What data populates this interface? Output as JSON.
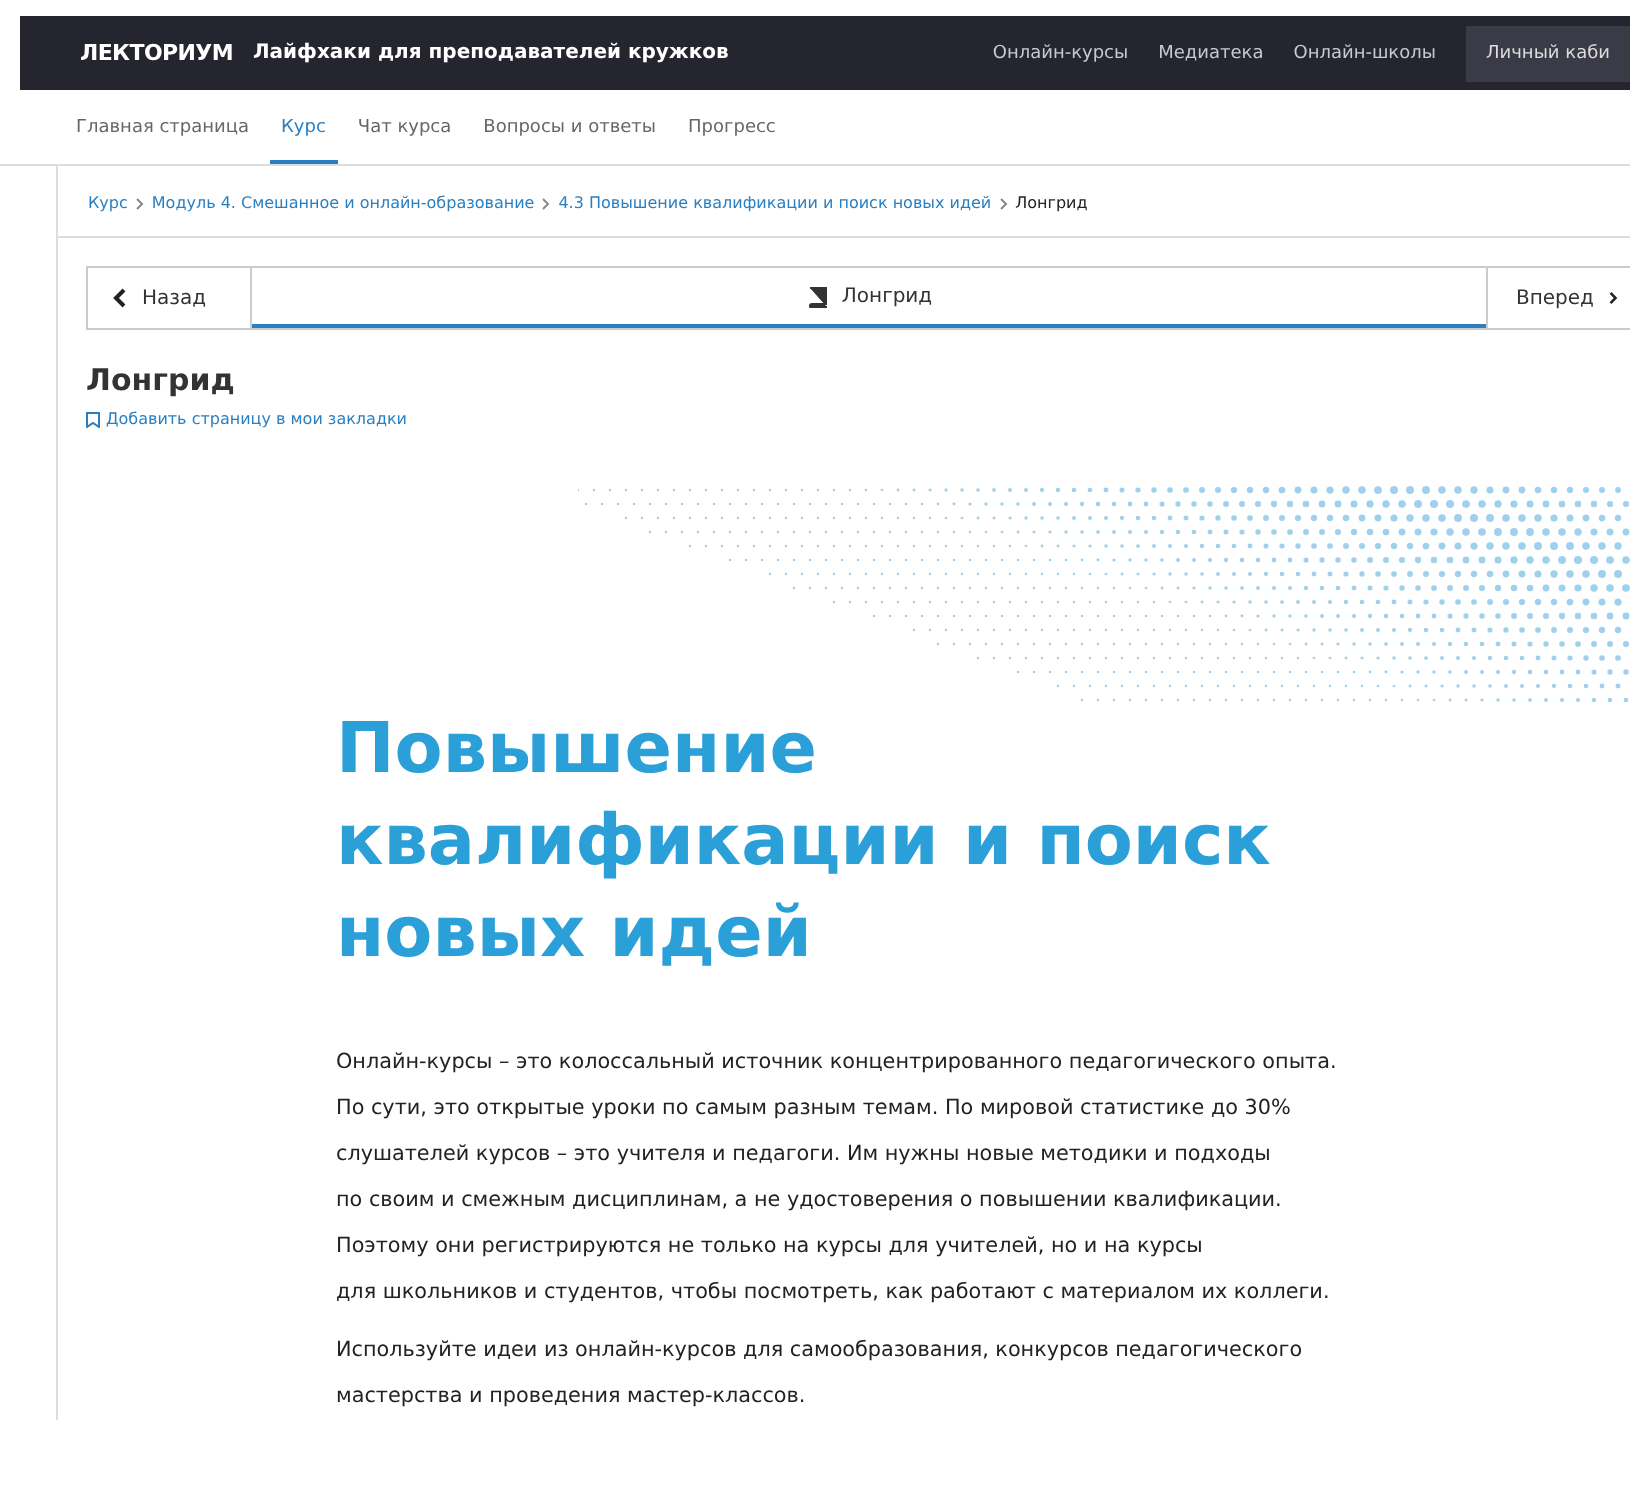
{
  "header": {
    "logo": "ЛЕКТОРИУМ",
    "title": "Лайфхаки для преподавателей кружков",
    "links": [
      "Онлайн-курсы",
      "Медиатека",
      "Онлайн-школы"
    ],
    "account_button": "Личный каби"
  },
  "tabs": [
    {
      "label": "Главная страница",
      "selected": false
    },
    {
      "label": "Курс",
      "selected": true
    },
    {
      "label": "Чат курса",
      "selected": false
    },
    {
      "label": "Вопросы и ответы",
      "selected": false
    },
    {
      "label": "Прогресс",
      "selected": false
    }
  ],
  "breadcrumbs": [
    {
      "label": "Курс",
      "current": false
    },
    {
      "label": "Модуль 4. Смешанное и онлайн-образование",
      "current": false
    },
    {
      "label": "4.3 Повышение квалификации и поиск новых идей",
      "current": false
    },
    {
      "label": "Лонгрид",
      "current": true
    }
  ],
  "unit_nav": {
    "back": "Назад",
    "current": "Лонгрид",
    "forward": "Вперед"
  },
  "page_title": "Лонгрид",
  "bookmark_link": "Добавить страницу в мои закладки",
  "article": {
    "heading_lines": [
      "Повышение",
      "квалификации и поиск",
      "новых идей"
    ],
    "paragraphs": [
      [
        "Онлайн-курсы – это колоссальный источник концентрированного педагогического опыта.",
        "По сути, это открытые уроки по самым разным темам. По мировой статистике до 30%",
        "слушателей курсов – это учителя и педагоги. Им нужны новые методики и подходы",
        "по своим и смежным дисциплинам, а не удостоверения о повышении квалификации.",
        "Поэтому они регистрируются не только на курсы для учителей, но и на курсы",
        "для школьников и студентов, чтобы посмотреть, как работают с материалом их коллеги."
      ],
      [
        "Используйте идеи из онлайн-курсов для самообразования, конкурсов педагогического",
        "мастерства и проведения мастер-классов."
      ]
    ]
  }
}
